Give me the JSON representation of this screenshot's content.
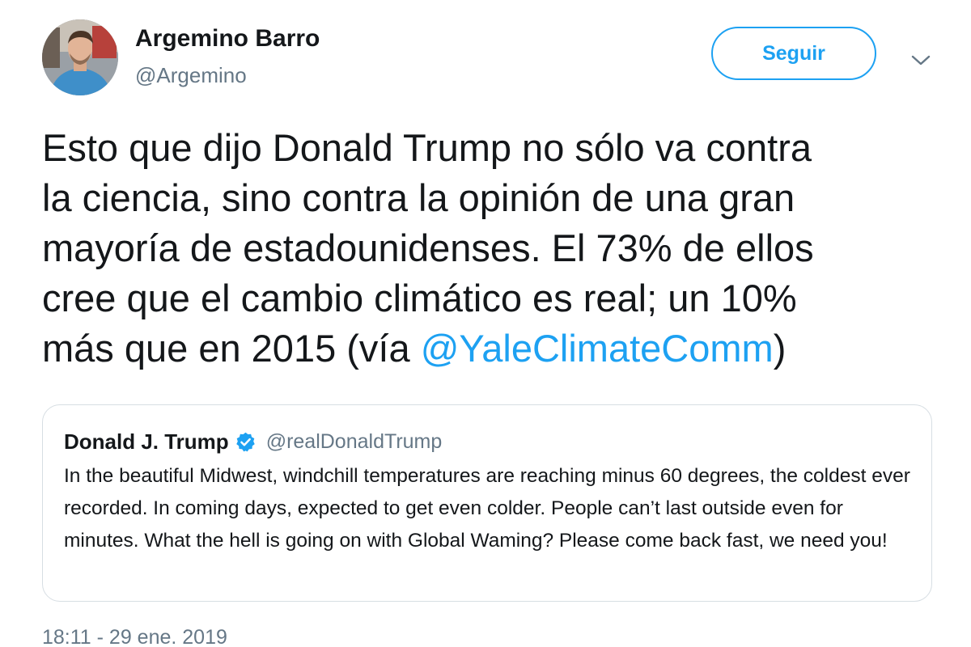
{
  "author": {
    "name": "Argemino Barro",
    "handle": "@Argemino",
    "avatar": "profile-photo"
  },
  "follow_button": {
    "label": "Seguir"
  },
  "menu": {
    "icon": "chevron-down-icon"
  },
  "tweet": {
    "text_lines": [
      "Esto que dijo Donald Trump no sólo va contra",
      "la ciencia, sino contra la opinión de una gran",
      "mayoría de estadounidenses. El 73% de ellos",
      "cree que el cambio climático es real; un 10%",
      "más que en 2015 (vía "
    ],
    "mention": "@YaleClimateComm",
    "closing": ")"
  },
  "quoted_tweet": {
    "name": "Donald J. Trump",
    "verified_icon": "verified-badge-icon",
    "handle": "@realDonaldTrump",
    "text": "In the beautiful Midwest, windchill temperatures are reaching minus 60 degrees, the coldest ever recorded. In coming days, expected to get even colder. People can’t last outside even for minutes. What the hell is going on with Global Waming? Please come back fast, we need you!"
  },
  "timestamp": "18:11 - 29 ene. 2019",
  "colors": {
    "accent": "#1da1f2",
    "text": "#14171a",
    "secondary_text": "#657786",
    "border": "#d7dee3"
  }
}
